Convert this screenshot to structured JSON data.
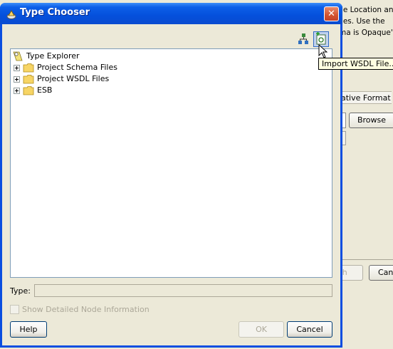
{
  "background": {
    "text_lines": [
      "ile Location an",
      "iles. Use the",
      "ma is Opaque',"
    ],
    "tab_label": "ative Format",
    "browse_label": "Browse",
    "finish_label": "sh",
    "cancel_label": "Can"
  },
  "dialog": {
    "title": "Type Chooser",
    "close_glyph": "✕",
    "toolbar": {
      "tooltip": "Import WSDL File..."
    },
    "tree": {
      "root": "Type Explorer",
      "items": [
        {
          "label": "Project Schema Files"
        },
        {
          "label": "Project WSDL Files"
        },
        {
          "label": "ESB"
        }
      ]
    },
    "type_field": {
      "label": "Type:",
      "value": ""
    },
    "show_details": {
      "label": "Show Detailed Node Information",
      "checked": false
    },
    "buttons": {
      "help": "Help",
      "ok": "OK",
      "cancel": "Cancel"
    }
  },
  "colors": {
    "titlebar": "#0a4ee0",
    "dialog_face": "#ece9d8",
    "tooltip_bg": "#ffffe1"
  },
  "icons": [
    "type-chooser-icon",
    "close-icon",
    "hierarchy-icon",
    "import-wsdl-icon",
    "type-explorer-icon",
    "folder-icon",
    "expand-icon",
    "cursor-icon"
  ]
}
